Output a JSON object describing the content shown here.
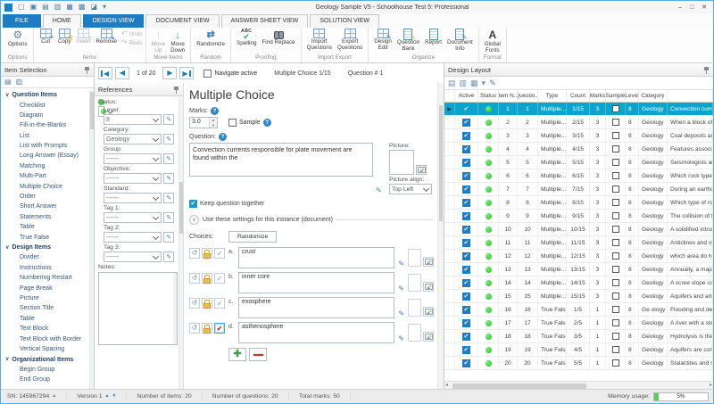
{
  "window": {
    "title": "Geology Sample V5 - Schoolhouse Test 5: Professional",
    "qat_icons": [
      "app-icon",
      "new-document-icon",
      "open-icon",
      "save-icon",
      "save-as-icon",
      "save-copy-icon",
      "print-icon",
      "folder-icon",
      "qat-dropdown-icon"
    ],
    "control_icons": [
      "minimize-icon",
      "maximize-icon",
      "close-icon"
    ]
  },
  "icons": {
    "app-icon": "css",
    "new-document-icon": "▢",
    "open-icon": "▣",
    "save-icon": "▤",
    "save-as-icon": "▥",
    "save-copy-icon": "▦",
    "print-icon": "▩",
    "folder-icon": "◪",
    "qat-dropdown-icon": "▾",
    "minimize-icon": "–",
    "maximize-icon": "□",
    "close-icon": "✕",
    "gear-icon": "⚙",
    "cut-icon": "css",
    "copy-icon": "css",
    "insert-icon": "css",
    "remove-icon": "css",
    "undo-icon": "↶",
    "redo-icon": "↷",
    "move-up-icon": "↑",
    "move-down-icon": "↓",
    "randomize-icon": "⇄",
    "spelling-icon": "css",
    "find-replace-icon": "css",
    "import-questions-icon": "css",
    "export-questions-icon": "css",
    "design-edit-icon": "css",
    "question-bank-icon": "css",
    "report-icon": "css",
    "document-info-icon": "css",
    "global-fonts-icon": "A",
    "pin-icon": "css",
    "expand-all-icon": "▤",
    "collapse-all-icon": "▥",
    "chevron-icon": "∨",
    "first-icon": "css",
    "prev-icon": "◀",
    "next-icon": "▶",
    "last-icon": "css",
    "dropdown-icon": "css",
    "help-icon": "css",
    "edit-note-icon": "✎",
    "power-icon": "↺",
    "lock-icon": "css",
    "picture-icon": "css",
    "spin-up-icon": "▴",
    "spin-down-icon": "▾",
    "collapse-icon": "∨",
    "layout-1-icon": "▤",
    "layout-2-icon": "▥",
    "layout-3-icon": "▦",
    "layout-dropdown-icon": "▾",
    "filter-edit-icon": "✎",
    "sn-warning-icon": "▲",
    "version-up-icon": "▲",
    "version-down-icon": "▼",
    "hscroll-left-icon": "◂",
    "hscroll-right-icon": "▸",
    "add-icon": "✚",
    "remove-minus-icon": "▬",
    "selected-row-icon": "▸"
  },
  "ribbon": {
    "tabs": [
      {
        "label": "FILE",
        "file": true
      },
      {
        "label": "HOME"
      },
      {
        "label": "DESIGN VIEW",
        "active": true
      },
      {
        "label": "DOCUMENT VIEW"
      },
      {
        "label": "ANSWER SHEET VIEW"
      },
      {
        "label": "SOLUTION VIEW"
      }
    ],
    "groups": [
      {
        "label": "Options",
        "buttons": [
          {
            "label": "Options",
            "icon": "gear-icon"
          }
        ]
      },
      {
        "label": "Items",
        "buttons": [
          {
            "label": "Cut",
            "icon": "cut-icon"
          },
          {
            "label": "Copy",
            "icon": "copy-icon"
          },
          {
            "label": "Insert",
            "icon": "insert-icon",
            "disabled": true
          },
          {
            "label": "Remove",
            "icon": "remove-icon"
          }
        ],
        "stack": [
          {
            "label": "Undo",
            "icon": "undo-icon",
            "disabled": true
          },
          {
            "label": "Redo",
            "icon": "redo-icon",
            "disabled": true
          }
        ]
      },
      {
        "label": "Move Items",
        "buttons": [
          {
            "label": "Move\nUp",
            "icon": "move-up-icon",
            "disabled": true
          },
          {
            "label": "Move\nDown",
            "icon": "move-down-icon"
          }
        ]
      },
      {
        "label": "Random",
        "buttons": [
          {
            "label": "Randomize",
            "icon": "randomize-icon"
          }
        ]
      },
      {
        "label": "Proofing",
        "buttons": [
          {
            "label": "Spelling",
            "icon": "spelling-icon"
          },
          {
            "label": "Find Replace",
            "icon": "find-replace-icon"
          }
        ]
      },
      {
        "label": "Import Export",
        "buttons": [
          {
            "label": "Import\nQuestions",
            "icon": "import-questions-icon"
          },
          {
            "label": "Export\nQuestions",
            "icon": "export-questions-icon"
          }
        ]
      },
      {
        "label": "Organize",
        "buttons": [
          {
            "label": "Design\nEdit",
            "icon": "design-edit-icon"
          },
          {
            "label": "Question\nBank",
            "icon": "question-bank-icon"
          },
          {
            "label": "Report",
            "icon": "report-icon"
          },
          {
            "label": "Document\nInfo",
            "icon": "document-info-icon"
          }
        ]
      },
      {
        "label": "Format",
        "buttons": [
          {
            "label": "Global\nFonts",
            "icon": "global-fonts-icon"
          }
        ]
      }
    ]
  },
  "sidebar": {
    "title": "Item Selection",
    "tool_icons": [
      "expand-all-icon",
      "collapse-all-icon"
    ],
    "sections": [
      {
        "label": "Question Items",
        "items": [
          "Checklist",
          "Diagram",
          "Fill-in-the-Blanks",
          "List",
          "List with Prompts",
          "Long Answer (Essay)",
          "Matching",
          "Multi-Part",
          "Multiple Choice",
          "Order",
          "Short Answer",
          "Statements",
          "Table",
          "True False"
        ]
      },
      {
        "label": "Design Items",
        "items": [
          "Divider",
          "Instructions",
          "Numbering Restart",
          "Page Break",
          "Picture",
          "Section Title",
          "Table",
          "Text Block",
          "Text Block with Border",
          "Vertical Spacing"
        ]
      },
      {
        "label": "Organizational Items",
        "items": [
          "Begin Group",
          "End Group"
        ]
      }
    ]
  },
  "navbar": {
    "position": "1 of 20",
    "navigate_active": "Navigate active",
    "type_counter": "Multiple Choice  1/15",
    "question_counter": "Question # 1"
  },
  "references": {
    "title": "References",
    "fields": [
      {
        "label": "Status:",
        "value": "Completed",
        "dot": true
      },
      {
        "label": "Level:",
        "value": "8",
        "editor": true
      },
      {
        "label": "Category:",
        "value": "Geology",
        "editor": true
      },
      {
        "label": "Group:",
        "value": "------",
        "editor": true
      },
      {
        "label": "Objective:",
        "value": "------",
        "editor": true
      },
      {
        "label": "Standard:",
        "value": "------",
        "editor": true
      },
      {
        "label": "Tag 1:",
        "value": "------",
        "editor": true
      },
      {
        "label": "Tag 2:",
        "value": "------",
        "editor": true
      },
      {
        "label": "Tag 3:",
        "value": "------",
        "editor": true
      }
    ],
    "notes_label": "Notes:"
  },
  "editor": {
    "title": "Multiple Choice",
    "marks_label": "Marks:",
    "marks_value": "3.0",
    "sample_label": "Sample",
    "question_label": "Question:",
    "question_text": "Convection currents responsible for plate movement are found within the",
    "picture_label": "Picture:",
    "picture_align_label": "Picture align:",
    "picture_align_value": "Top Left",
    "keep_together": "Keep question together",
    "instance_settings": "Use these settings for this instance (document)",
    "choices_label": "Choices:",
    "randomize_button": "Randomize",
    "choices": [
      {
        "letter": "a.",
        "text": "crust"
      },
      {
        "letter": "b.",
        "text": "inner core"
      },
      {
        "letter": "c.",
        "text": "exosphere"
      },
      {
        "letter": "d.",
        "text": "asthenosphere",
        "correct": true
      }
    ]
  },
  "design_layout": {
    "title": "Design Layout",
    "tool_icons": [
      "layout-1-icon",
      "layout-2-icon",
      "layout-3-icon",
      "layout-dropdown-icon",
      "filter-edit-icon"
    ],
    "columns": [
      "",
      "Active",
      "Status",
      "Item N...",
      "Questio...",
      "Type",
      "Count",
      "Marks",
      "Sample",
      "Level",
      "Category",
      ""
    ],
    "rows": [
      {
        "item": "1",
        "question": "1",
        "type": "Multiple...",
        "count": "1/15",
        "marks": "3",
        "level": "8",
        "category": "Geology",
        "text": "Convection currents re",
        "selected": true
      },
      {
        "item": "2",
        "question": "2",
        "type": "Multiple...",
        "count": "2/15",
        "marks": "3",
        "level": "8",
        "category": "Geology",
        "text": "When a block of the e"
      },
      {
        "item": "3",
        "question": "3",
        "type": "Multiple...",
        "count": "3/15",
        "marks": "3",
        "level": "8",
        "category": "Geology",
        "text": "Coal deposits are form"
      },
      {
        "item": "4",
        "question": "4",
        "type": "Multiple...",
        "count": "4/15",
        "marks": "3",
        "level": "8",
        "category": "Geology",
        "text": "Features associated w"
      },
      {
        "item": "5",
        "question": "5",
        "type": "Multiple...",
        "count": "5/15",
        "marks": "3",
        "level": "8",
        "category": "Geology",
        "text": "Seismologists are asso"
      },
      {
        "item": "6",
        "question": "6",
        "type": "Multiple...",
        "count": "6/15",
        "marks": "3",
        "level": "8",
        "category": "Geology",
        "text": "Which rock type has b"
      },
      {
        "item": "7",
        "question": "7",
        "type": "Multiple...",
        "count": "7/15",
        "marks": "3",
        "level": "8",
        "category": "Geology",
        "text": "During an earthquake"
      },
      {
        "item": "8",
        "question": "8",
        "type": "Multiple...",
        "count": "8/15",
        "marks": "3",
        "level": "8",
        "category": "Geology",
        "text": "Which type of rock is"
      },
      {
        "item": "9",
        "question": "9",
        "type": "Multiple...",
        "count": "9/15",
        "marks": "3",
        "level": "8",
        "category": "Geology",
        "text": "The collision of the In"
      },
      {
        "item": "10",
        "question": "10",
        "type": "Multiple...",
        "count": "10/15",
        "marks": "3",
        "level": "8",
        "category": "Geology",
        "text": "A solidified intrusion"
      },
      {
        "item": "11",
        "question": "11",
        "type": "Multiple...",
        "count": "11/15",
        "marks": "3",
        "level": "8",
        "category": "Geology",
        "text": "Anticlines and synclin"
      },
      {
        "item": "12",
        "question": "12",
        "type": "Multiple...",
        "count": "12/15",
        "marks": "3",
        "level": "8",
        "category": "Geology",
        "text": "which area do high m"
      },
      {
        "item": "13",
        "question": "13",
        "type": "Multiple...",
        "count": "13/15",
        "marks": "3",
        "level": "8",
        "category": "Geology",
        "text": "Annually, a major caus"
      },
      {
        "item": "14",
        "question": "14",
        "type": "Multiple...",
        "count": "14/15",
        "marks": "3",
        "level": "8",
        "category": "Geology",
        "text": "A scree slope consists"
      },
      {
        "item": "15",
        "question": "15",
        "type": "Multiple...",
        "count": "15/15",
        "marks": "3",
        "level": "8",
        "category": "Geology",
        "text": "Aquifers and artesian"
      },
      {
        "item": "16",
        "question": "16",
        "type": "True False",
        "count": "1/5",
        "marks": "1",
        "level": "8",
        "category": "Ge ology",
        "text": "Flooding and deposit"
      },
      {
        "item": "17",
        "question": "17",
        "type": "True False",
        "count": "2/5",
        "marks": "1",
        "level": "8",
        "category": "Geology",
        "text": "A river with a steep gr"
      },
      {
        "item": "18",
        "question": "18",
        "type": "True False",
        "count": "3/5",
        "marks": "1",
        "level": "8",
        "category": "Geology",
        "text": "Hydrolysis is the meth"
      },
      {
        "item": "19",
        "question": "19",
        "type": "True False",
        "count": "4/5",
        "marks": "1",
        "level": "8",
        "category": "Geology",
        "text": "Aquifers are compose"
      },
      {
        "item": "20",
        "question": "20",
        "type": "True False",
        "count": "5/5",
        "marks": "1",
        "level": "8",
        "category": "Geology",
        "text": "Stalactites and stalag"
      }
    ]
  },
  "statusbar": {
    "sn_label": "SN:  145967294",
    "version_label": "Version 1",
    "items_label": "Number of items: 20",
    "questions_label": "Number of questions: 20",
    "marks_label": "Total marks: 50",
    "memory_label": "Memory usage:",
    "memory_value": "5%",
    "memory_percent": 8
  }
}
